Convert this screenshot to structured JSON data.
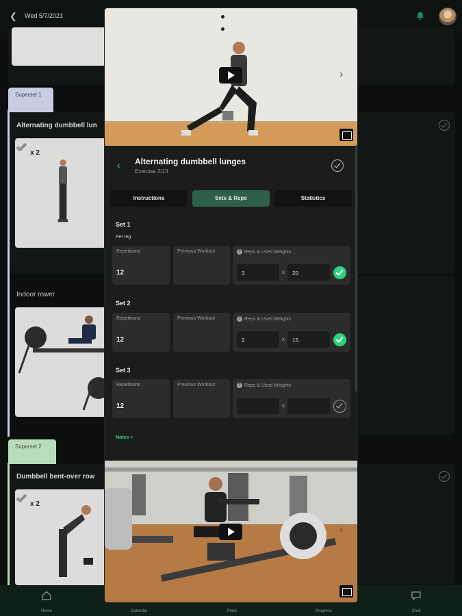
{
  "header": {
    "date": "Wed 5/7/2023"
  },
  "background": {
    "superset_1_label": "Superset 1",
    "superset_2_label": "Superset 2",
    "exercise_1_title": "Alternating dumbbell lun",
    "exercise_2_title": "Indoor rower",
    "exercise_3_title": "Dumbbell bent-over row",
    "dumbbell_count_1": "x 2",
    "dumbbell_count_2": "x 2"
  },
  "bottom_nav": [
    {
      "label": "Home",
      "icon": "home-icon"
    },
    {
      "label": "Calendar",
      "icon": "calendar-icon"
    },
    {
      "label": "Plans",
      "icon": "plans-icon"
    },
    {
      "label": "Progress",
      "icon": "progress-icon"
    },
    {
      "label": "Chat",
      "icon": "chat-icon"
    }
  ],
  "modal": {
    "exercise_title": "Alternating dumbbell lunges",
    "exercise_sub": "Exercise 2/13",
    "tabs": [
      {
        "label": "Instructions",
        "active": false
      },
      {
        "label": "Sets & Reps",
        "active": true
      },
      {
        "label": "Statistics",
        "active": false
      }
    ],
    "per_leg": "Per leg",
    "labels": {
      "repetitions": "Repetitions",
      "previous": "Previous Workout",
      "reps_weights": "Reps & Used Weights",
      "x": "x"
    },
    "sets": [
      {
        "title": "Set 1",
        "repetitions": "12",
        "reps": "3",
        "weight": "20",
        "done": true
      },
      {
        "title": "Set 2",
        "repetitions": "12",
        "reps": "2",
        "weight": "15",
        "done": true
      },
      {
        "title": "Set 3",
        "repetitions": "12",
        "reps": "",
        "weight": "",
        "done": false
      }
    ],
    "notes_link": "Notes +"
  },
  "colors": {
    "accent": "#3ecf8e",
    "tab_active": "#2e5f4a",
    "check_on": "#2fd07e"
  }
}
